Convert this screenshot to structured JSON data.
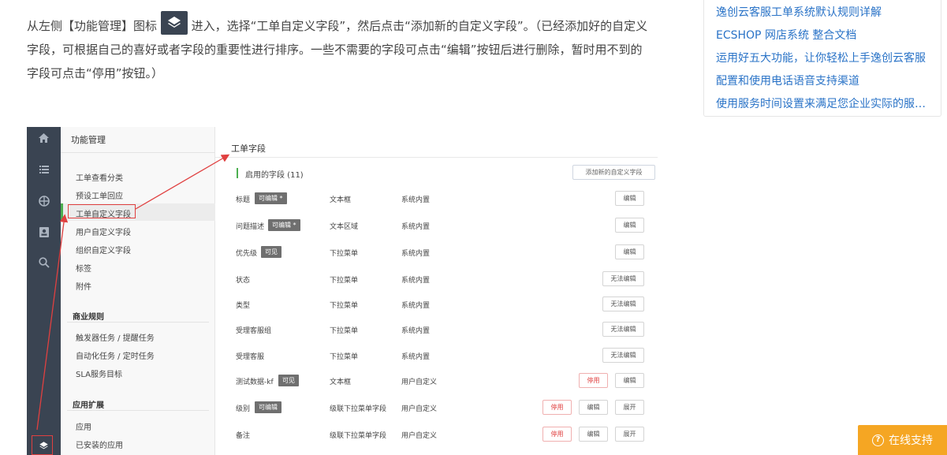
{
  "article": {
    "text_before_icon": "从左侧【功能管理】图标",
    "text_after_icon": "进入，选择“工单自定义字段”，然后点击“添加新的自定义字段”。（已经添加好的自定义字段，可根据自己的喜好或者字段的重要性进行排序。一些不需要的字段可点击“编辑”按钮后进行删除，暂时用不到的字段可点击“停用”按钮。）"
  },
  "related": [
    "逸创云客服工单系统默认规则详解",
    "ECSHOP 网店系统 整合文档",
    "运用好五大功能，让你轻松上手逸创云客服",
    "配置和使用电话语音支持渠道",
    "使用服务时间设置来满足您企业实际的服务..."
  ],
  "rail_icons": [
    "home-icon",
    "list-icon",
    "globe-icon",
    "contact-card-icon",
    "search-icon",
    "layers-icon"
  ],
  "menu": {
    "header": "功能管理",
    "group1": [
      "工单查看分类",
      "预设工单回应",
      "工单自定义字段",
      "用户自定义字段",
      "组织自定义字段",
      "标签",
      "附件"
    ],
    "section2": "商业规则",
    "group2": [
      "触发器任务 / 提醒任务",
      "自动化任务 / 定时任务",
      "SLA服务目标"
    ],
    "section3": "应用扩展",
    "group3": [
      "应用",
      "已安装的应用"
    ]
  },
  "content": {
    "title": "工单字段",
    "enabled_label": "启用的字段 (11)",
    "add_button": "添加新的自定义字段",
    "rows": [
      {
        "name": "标题",
        "tag": "可编辑 *",
        "type": "文本框",
        "source": "系统内置",
        "actions": [
          "编辑"
        ]
      },
      {
        "name": "问题描述",
        "tag": "可编辑 *",
        "type": "文本区域",
        "source": "系统内置",
        "actions": [
          "编辑"
        ]
      },
      {
        "name": "优先级",
        "tag": "可见",
        "type": "下拉菜单",
        "source": "系统内置",
        "actions": [
          "编辑"
        ]
      },
      {
        "name": "状态",
        "tag": "",
        "type": "下拉菜单",
        "source": "系统内置",
        "actions": [
          "无法编辑"
        ]
      },
      {
        "name": "类型",
        "tag": "",
        "type": "下拉菜单",
        "source": "系统内置",
        "actions": [
          "无法编辑"
        ]
      },
      {
        "name": "受理客服组",
        "tag": "",
        "type": "下拉菜单",
        "source": "系统内置",
        "actions": [
          "无法编辑"
        ]
      },
      {
        "name": "受理客服",
        "tag": "",
        "type": "下拉菜单",
        "source": "系统内置",
        "actions": [
          "无法编辑"
        ]
      },
      {
        "name": "测试数据-kf",
        "tag": "可见",
        "type": "文本框",
        "source": "用户自定义",
        "actions": [
          "停用",
          "编辑"
        ]
      },
      {
        "name": "级别",
        "tag": "可编辑",
        "type": "级联下拉菜单字段",
        "source": "用户自定义",
        "actions": [
          "停用",
          "编辑",
          "展开"
        ]
      },
      {
        "name": "备注",
        "tag": "",
        "type": "级联下拉菜单字段",
        "source": "用户自定义",
        "actions": [
          "停用",
          "编辑",
          "展开"
        ]
      }
    ]
  },
  "support": {
    "label": "在线支持"
  },
  "colors": {
    "rail": "#3a4452",
    "link": "#2a73c7",
    "support": "#f5a623",
    "accent_green": "#4caf50",
    "annotation_red": "#e04040"
  }
}
